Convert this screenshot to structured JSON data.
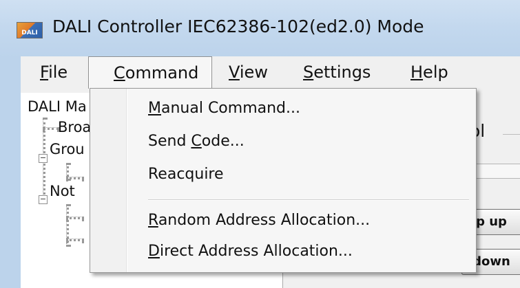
{
  "window": {
    "title": "DALI Controller IEC62386-102(ed2.0) Mode",
    "icon_text": "DALI"
  },
  "menubar": {
    "items": [
      {
        "mnemonic": "F",
        "rest": "ile"
      },
      {
        "mnemonic": "C",
        "rest": "ommand"
      },
      {
        "mnemonic": "V",
        "rest": "iew"
      },
      {
        "mnemonic": "S",
        "rest": "ettings"
      },
      {
        "mnemonic": "H",
        "rest": "elp"
      }
    ]
  },
  "command_menu": {
    "items": [
      {
        "pre": "",
        "mnemonic": "M",
        "post": "anual Command..."
      },
      {
        "pre": "Send ",
        "mnemonic": "C",
        "post": "ode..."
      },
      {
        "pre": "Reacquire",
        "mnemonic": "",
        "post": ""
      },
      {
        "pre": "",
        "mnemonic": "R",
        "post": "andom Address Allocation..."
      },
      {
        "pre": "",
        "mnemonic": "D",
        "post": "irect Address Allocation..."
      }
    ]
  },
  "tree": {
    "nodes": [
      "DALI Ma",
      "Broa",
      "Grou",
      "Not"
    ]
  },
  "right_panel": {
    "group_title": "ol",
    "up_button": "p up",
    "down_button": "down"
  }
}
